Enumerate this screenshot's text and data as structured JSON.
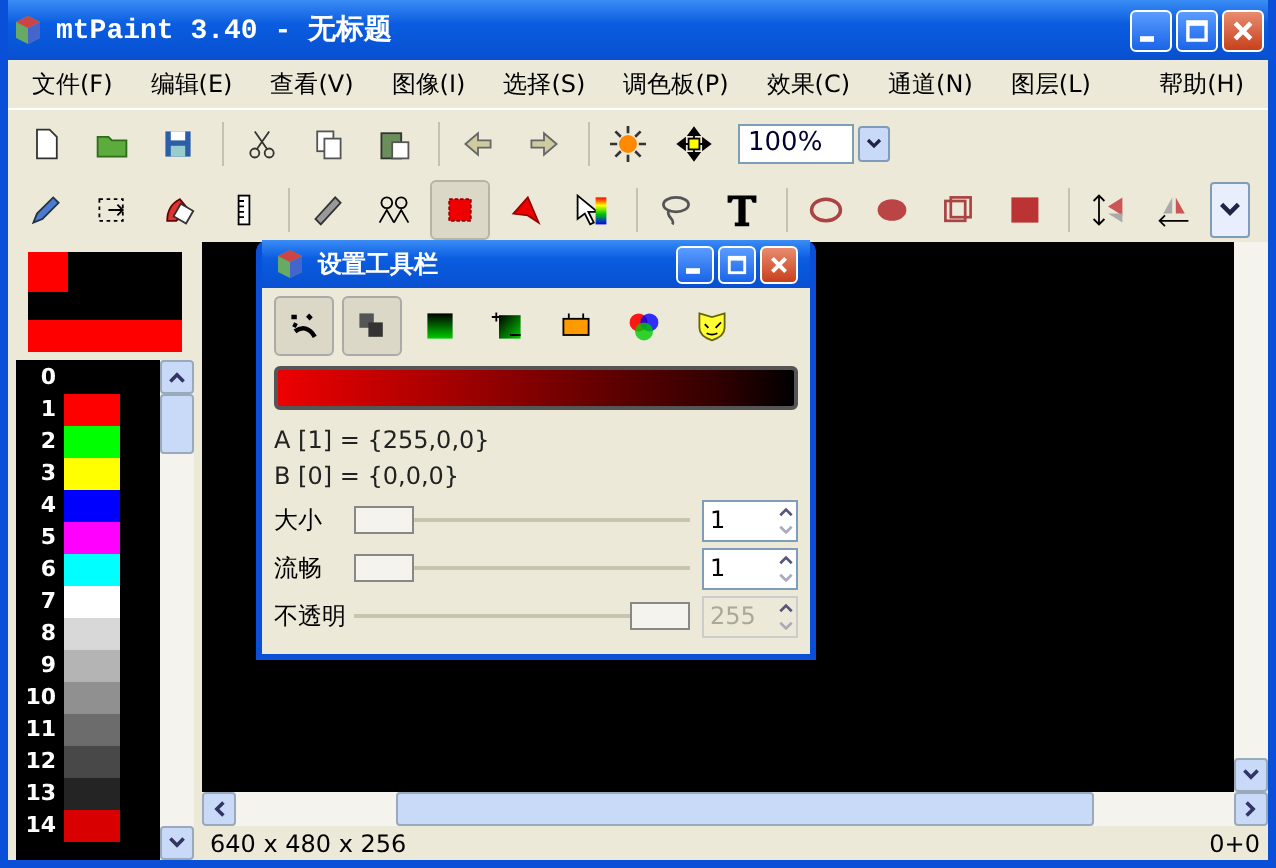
{
  "window": {
    "title": "mtPaint 3.40 - 无标题"
  },
  "menu": [
    {
      "label": "文件(F)"
    },
    {
      "label": "编辑(E)"
    },
    {
      "label": "查看(V)"
    },
    {
      "label": "图像(I)"
    },
    {
      "label": "选择(S)"
    },
    {
      "label": "调色板(P)"
    },
    {
      "label": "效果(C)"
    },
    {
      "label": "通道(N)"
    },
    {
      "label": "图层(L)"
    },
    {
      "label": "帮助(H)"
    }
  ],
  "toolbar1": {
    "zoom": "100%"
  },
  "toolbar2": {
    "tools": [
      {
        "selected": false
      },
      {
        "selected": false
      },
      {
        "selected": false
      },
      {
        "selected": false
      },
      {
        "selected": false
      },
      {
        "selected": false
      },
      {
        "selected": true
      },
      {
        "selected": false
      },
      {
        "selected": false
      },
      {
        "selected": false
      },
      {
        "selected": false
      },
      {
        "selected": false
      },
      {
        "selected": false
      },
      {
        "selected": false
      },
      {
        "selected": false
      },
      {
        "selected": false
      },
      {
        "selected": false
      }
    ]
  },
  "colours": [
    {
      "color": "#ff0000"
    },
    {
      "color": "#000000"
    }
  ],
  "palette": [
    {
      "label": "0"
    },
    {
      "label": "1",
      "color": "#ff0000"
    },
    {
      "label": "2",
      "color": "#00ff00"
    },
    {
      "label": "3",
      "color": "#ffff00"
    },
    {
      "label": "4",
      "color": "#0000ff"
    },
    {
      "label": "5",
      "color": "#ff00ff"
    },
    {
      "label": "6",
      "color": "#00ffff"
    },
    {
      "label": "7",
      "color": "#ffffff"
    },
    {
      "label": "8",
      "color": "#d8d8d8"
    },
    {
      "label": "9",
      "color": "#b4b4b4"
    },
    {
      "label": "10",
      "color": "#909090"
    },
    {
      "label": "11",
      "color": "#6c6c6c"
    },
    {
      "label": "12",
      "color": "#484848"
    },
    {
      "label": "13",
      "color": "#242424"
    },
    {
      "label": "14",
      "color": "#d80000"
    }
  ],
  "dialog": {
    "title": "设置工具栏",
    "tools": [
      {
        "selected": true
      },
      {
        "selected": true
      },
      {
        "selected": false
      },
      {
        "selected": false
      },
      {
        "selected": false
      },
      {
        "selected": false
      },
      {
        "selected": false
      }
    ],
    "colour_a": "A [1] = {255,0,0}",
    "colour_b": "B [0] = {0,0,0}",
    "settings": [
      {
        "label": "大小",
        "level": 0,
        "value": "1",
        "disabled": false
      },
      {
        "label": "流畅",
        "level": 0,
        "value": "1",
        "disabled": false
      },
      {
        "label": "不透明",
        "level": 1,
        "value": "255",
        "disabled": true
      }
    ]
  },
  "status_bar": {
    "size": "640 x 480 x 256",
    "position": "0+0"
  }
}
